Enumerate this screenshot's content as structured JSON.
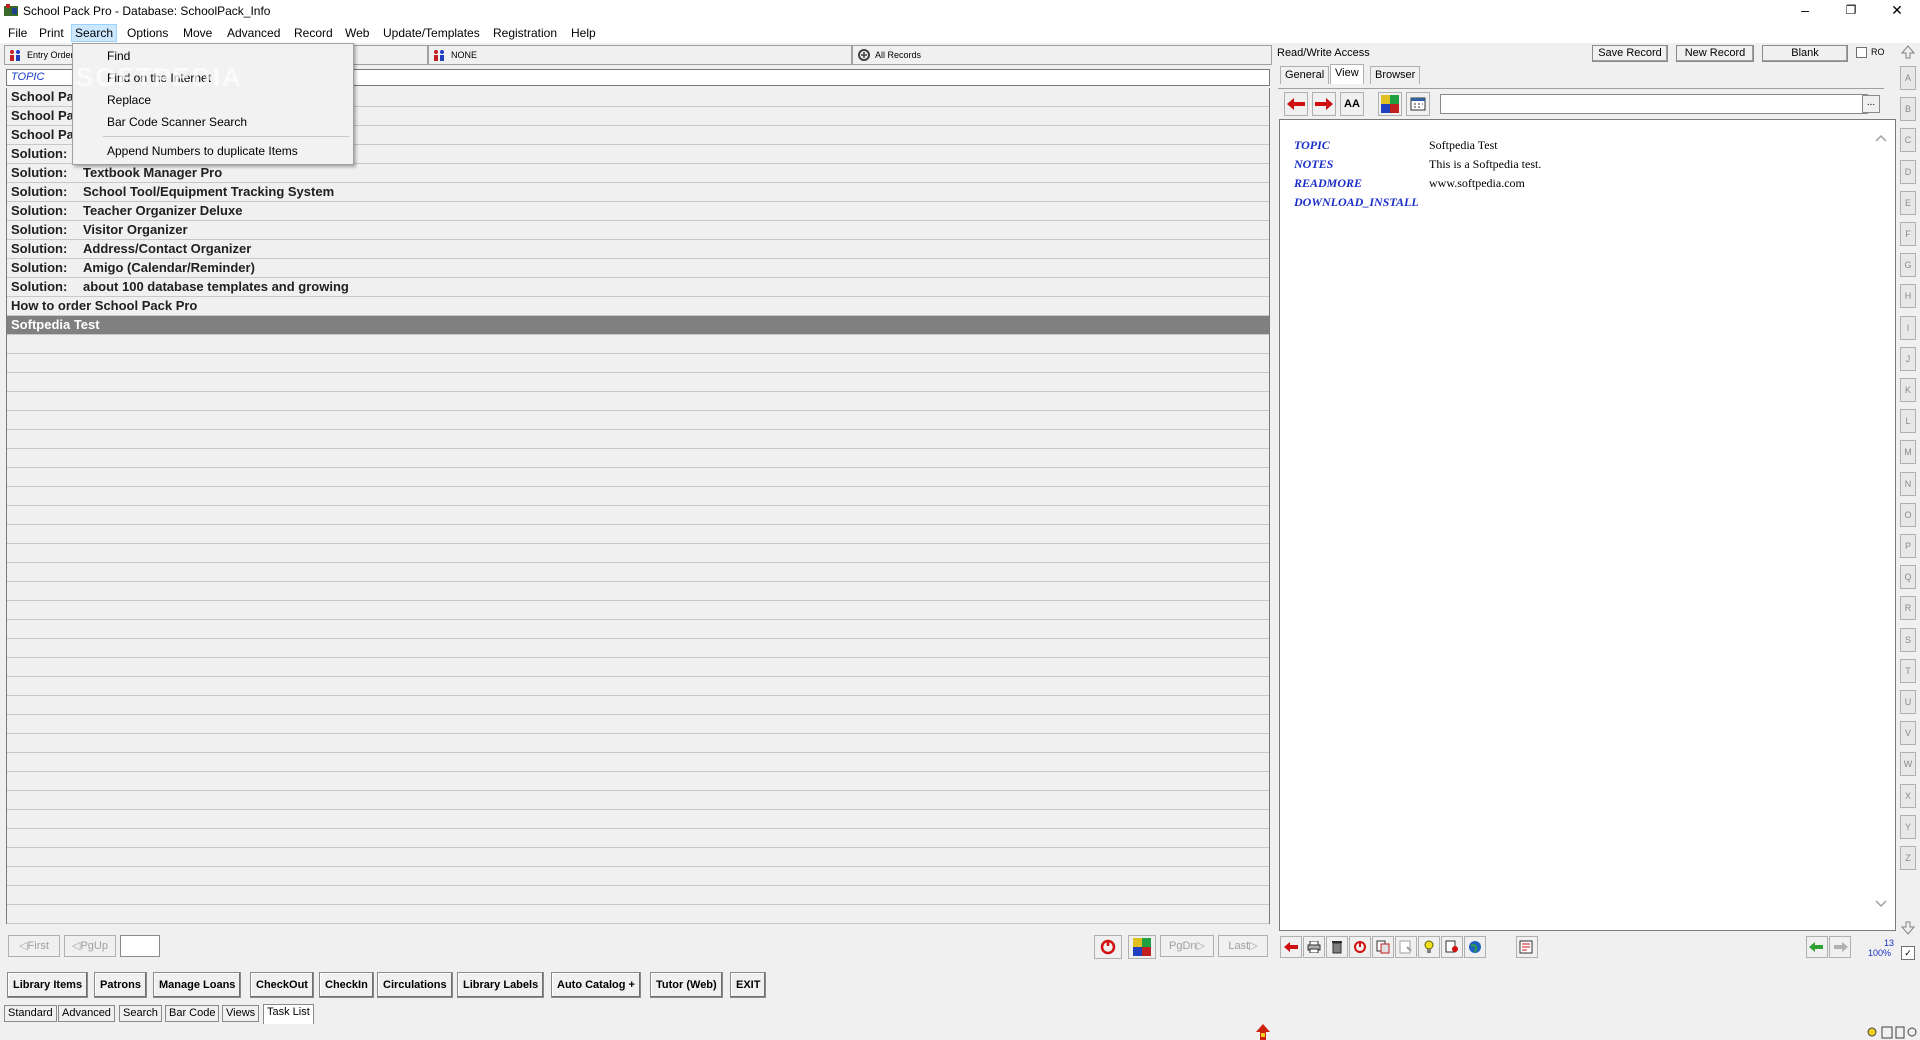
{
  "window": {
    "title": "School Pack Pro - Database: SchoolPack_Info",
    "controls": [
      "minimize",
      "restore",
      "close"
    ]
  },
  "menubar": {
    "items": [
      "File",
      "Print",
      "Search",
      "Options",
      "Move",
      "Advanced",
      "Record",
      "Web",
      "Update/Templates",
      "Registration",
      "Help"
    ],
    "active": "Search"
  },
  "search_menu": {
    "items": [
      "Find",
      "Find on the Internet",
      "Replace",
      "Bar Code Scanner Search",
      "Append Numbers to duplicate Items"
    ],
    "watermark": "SOFTPEDIA"
  },
  "filterbar": {
    "sort": "Entry Order",
    "group": "NONE",
    "scope": "All Records"
  },
  "list": {
    "column_header": "TOPIC",
    "rows": [
      {
        "c1": "School Pack Pro",
        "c2": ""
      },
      {
        "c1": "School Pack Pro",
        "c2": ""
      },
      {
        "c1": "School Pack Pro",
        "c2": ""
      },
      {
        "c1": "Solution:",
        "c2": ""
      },
      {
        "c1": "Solution:",
        "c2": "Textbook Manager Pro"
      },
      {
        "c1": "Solution:",
        "c2": "School Tool/Equipment Tracking System"
      },
      {
        "c1": "Solution:",
        "c2": "Teacher Organizer Deluxe"
      },
      {
        "c1": "Solution:",
        "c2": "Visitor Organizer"
      },
      {
        "c1": "Solution:",
        "c2": "Address/Contact Organizer"
      },
      {
        "c1": "Solution:",
        "c2": "Amigo (Calendar/Reminder)"
      },
      {
        "c1": "Solution:",
        "c2": "about 100 database templates and growing"
      },
      {
        "c1": "How to order School Pack Pro",
        "c2": ""
      },
      {
        "c1": "Softpedia Test",
        "c2": ""
      }
    ],
    "selected_index": 12
  },
  "navigation": {
    "first": "First",
    "pgup": "PgUp",
    "pgdn": "PgDn",
    "last": "Last",
    "goto_value": ""
  },
  "task_buttons": [
    "Library Items",
    "Patrons",
    "Manage Loans",
    "CheckOut",
    "CheckIn",
    "Circulations",
    "Library Labels",
    "Auto Catalog +",
    "Tutor (Web)",
    "EXIT"
  ],
  "bottom_tabs": {
    "items": [
      "Standard",
      "Advanced",
      "Search",
      "Bar Code",
      "Views",
      "Task List"
    ],
    "active": "Task List"
  },
  "right_panel": {
    "access": "Read/Write Access",
    "save_label": "Save Record",
    "new_label": "New Record",
    "blank_label": "Blank",
    "ro_label": "RO",
    "tabs": [
      "General",
      "View",
      "Browser"
    ],
    "active_tab": "View",
    "fields": [
      {
        "name": "TOPIC",
        "value": "Softpedia Test"
      },
      {
        "name": "NOTES",
        "value": "This is a Softpedia test."
      },
      {
        "name": "READMORE",
        "value": "www.softpedia.com"
      },
      {
        "name": "DOWNLOAD_INSTALL",
        "value": ""
      }
    ],
    "zoom_number": "13",
    "zoom_percent": "100%"
  },
  "alphabet": [
    "A",
    "B",
    "C",
    "D",
    "E",
    "F",
    "G",
    "H",
    "I",
    "J",
    "K",
    "L",
    "M",
    "N",
    "O",
    "P",
    "Q",
    "R",
    "S",
    "T",
    "U",
    "V",
    "W",
    "X",
    "Y",
    "Z"
  ],
  "colors": {
    "field_name": "#1a2ec8",
    "selected_row": "#808080",
    "menu_highlight": "#cce8ff"
  }
}
